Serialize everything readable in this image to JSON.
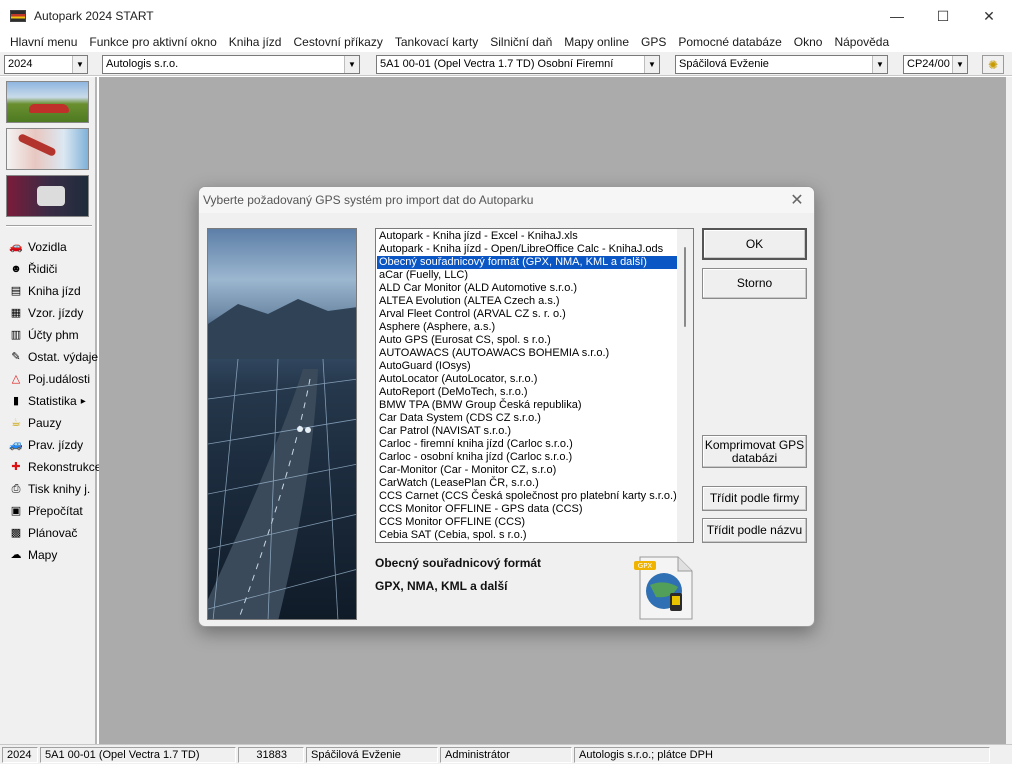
{
  "window": {
    "title": "Autopark 2024 START",
    "minimize": "—",
    "maximize": "☐",
    "close": "✕"
  },
  "menu": [
    "Hlavní menu",
    "Funkce pro aktivní okno",
    "Kniha jízd",
    "Cestovní příkazy",
    "Tankovací karty",
    "Silniční daň",
    "Mapy online",
    "GPS",
    "Pomocné databáze",
    "Okno",
    "Nápověda"
  ],
  "toolbar": {
    "year": "2024",
    "company": "Autologis s.r.o.",
    "vehicle": "5A1 00-01 (Opel Vectra 1.7 TD) Osobní Firemní",
    "driver": "Spáčilová Evženie",
    "trip_order": "CP24/00"
  },
  "sidebar": {
    "items": [
      {
        "label": "Vozidla",
        "icon": "car-icon"
      },
      {
        "label": "Řidiči",
        "icon": "driver-icon"
      },
      {
        "label": "Kniha jízd",
        "icon": "book-icon"
      },
      {
        "label": "Vzor. jízdy",
        "icon": "template-trip-icon"
      },
      {
        "label": "Účty phm",
        "icon": "fuel-bill-icon"
      },
      {
        "label": "Ostat. výdaje",
        "icon": "expenses-icon"
      },
      {
        "label": "Poj.události",
        "icon": "warning-icon"
      },
      {
        "label": "Statistika",
        "icon": "statistics-icon"
      },
      {
        "label": "Pauzy",
        "icon": "pause-icon"
      },
      {
        "label": "Prav. jízdy",
        "icon": "regular-trips-icon"
      },
      {
        "label": "Rekonstrukce",
        "icon": "reconstruction-icon"
      },
      {
        "label": "Tisk knihy j.",
        "icon": "print-icon"
      },
      {
        "label": "Přepočítat",
        "icon": "recalculate-icon"
      },
      {
        "label": "Plánovač",
        "icon": "planner-icon"
      },
      {
        "label": "Mapy",
        "icon": "map-icon"
      }
    ],
    "submenu_arrow": "▸"
  },
  "dialog": {
    "title": "Vyberte požadovaný GPS systém pro import dat do Autoparku",
    "ok": "OK",
    "cancel": "Storno",
    "compress_db": "Komprimovat GPS databázi",
    "sort_by_company": "Třídit podle firmy",
    "sort_by_name": "Třídit podle názvu",
    "selected_index": 2,
    "list": [
      " Autopark - Kniha jízd - Excel - KnihaJ.xls",
      " Autopark - Kniha jízd - Open/LibreOffice Calc - KnihaJ.ods",
      " Obecný souřadnicový formát (GPX, NMA, KML a další)",
      "aCar (Fuelly, LLC)",
      "ALD Car Monitor (ALD Automotive s.r.o.)",
      "ALTEA Evolution (ALTEA Czech a.s.)",
      "Arval Fleet Control (ARVAL CZ s. r. o.)",
      "Asphere (Asphere, a.s.)",
      "Auto GPS (Eurosat CS, spol. s r.o.)",
      "AUTOAWACS (AUTOAWACS BOHEMIA s.r.o.)",
      "AutoGuard (IOsys)",
      "AutoLocator (AutoLocator, s.r.o.)",
      "AutoReport (DeMoTech, s.r.o.)",
      "BMW TPA (BMW Group Česká republika)",
      "Car Data System (CDS CZ s.r.o.)",
      "Car Patrol (NAVISAT s.r.o.)",
      "Carloc - firemní kniha jízd (Carloc s.r.o.)",
      "Carloc - osobní kniha jízd (Carloc s.r.o.)",
      "Car-Monitor (Car - Monitor CZ, s.r.o)",
      "CarWatch (LeasePlan ČR, s.r.o.)",
      "CCS Carnet (CCS Česká společnost pro platební karty s.r.o.)",
      "CCS Monitor OFFLINE - GPS data (CCS)",
      "CCS Monitor OFFLINE (CCS)",
      "Cebia SAT (Cebia, spol. s r.o.)"
    ],
    "desc_title": "Obecný souřadnicový formát",
    "desc_sub": "GPX, NMA, KML a další",
    "gpx_badge": "GPX"
  },
  "status": {
    "year": "2024",
    "vehicle": "5A1 00-01 (Opel Vectra 1.7 TD)",
    "odometer": "31883",
    "driver": "Spáčilová Evženie",
    "user": "Administrátor",
    "company": "Autologis s.r.o.;  plátce DPH"
  },
  "colors": {
    "selection": "#0a56c4",
    "workspace": "#ababab",
    "chrome": "#f0f0f0"
  }
}
